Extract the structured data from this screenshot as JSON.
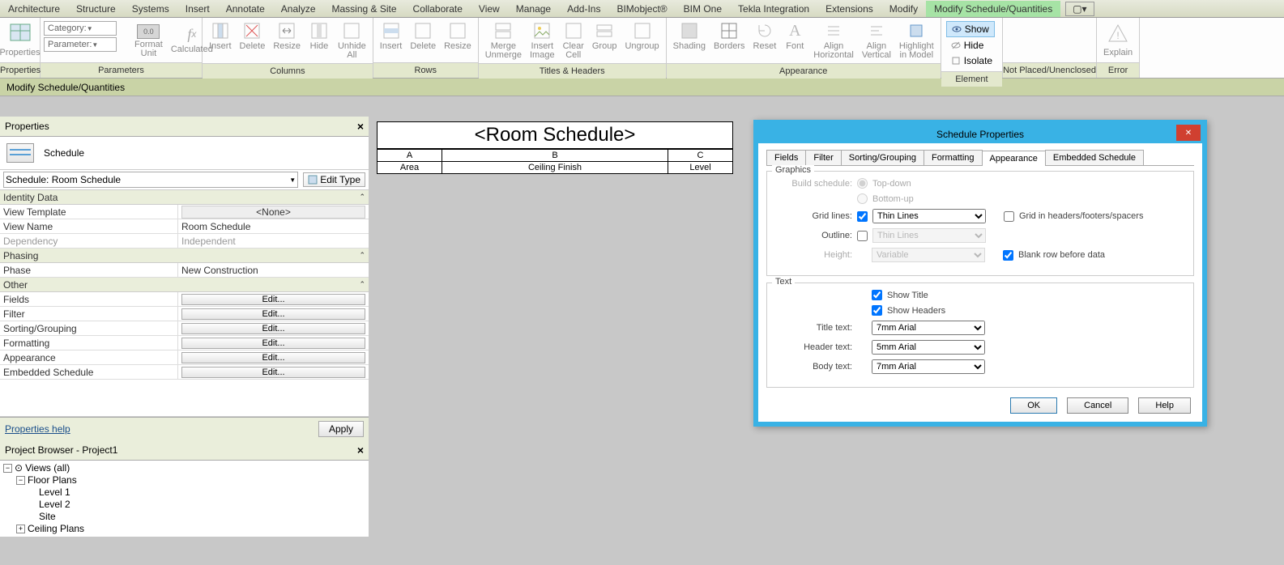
{
  "tabs": [
    "Architecture",
    "Structure",
    "Systems",
    "Insert",
    "Annotate",
    "Analyze",
    "Massing & Site",
    "Collaborate",
    "View",
    "Manage",
    "Add-Ins",
    "BIMobject®",
    "BIM One",
    "Tekla Integration",
    "Extensions",
    "Modify",
    "Modify Schedule/Quantities"
  ],
  "ribbon": {
    "properties": {
      "label": "Properties",
      "btn": "Properties",
      "category": "Category:",
      "parameter": "Parameter:",
      "format": "Format\nUnit",
      "calculated": "Calculated",
      "group": "Parameters"
    },
    "columns": {
      "insert": "Insert",
      "delete": "Delete",
      "resize": "Resize",
      "hide": "Hide",
      "unhide": "Unhide\nAll",
      "group": "Columns"
    },
    "rows": {
      "insert": "Insert",
      "delete": "Delete",
      "resize": "Resize",
      "group": "Rows"
    },
    "titles": {
      "merge": "Merge\nUnmerge",
      "image": "Insert\nImage",
      "clear": "Clear\nCell",
      "groupb": "Group",
      "ungroup": "Ungroup",
      "group": "Titles & Headers"
    },
    "appearance": {
      "shading": "Shading",
      "borders": "Borders",
      "reset": "Reset",
      "font": "Font",
      "alignh": "Align\nHorizontal",
      "alignv": "Align\nVertical",
      "highlight": "Highlight\nin Model",
      "group": "Appearance"
    },
    "element": {
      "show": "Show",
      "hide": "Hide",
      "isolate": "Isolate",
      "group": "Element"
    },
    "notplaced": {
      "explain": "Explain",
      "group": "Not Placed/Unenclosed",
      "error": "Error"
    }
  },
  "subtitle": "Modify Schedule/Quantities",
  "props": {
    "title": "Properties",
    "schedule": "Schedule",
    "typeRow": "Schedule: Room Schedule",
    "editType": "Edit Type",
    "identity": "Identity Data",
    "phasing": "Phasing",
    "other": "Other",
    "rows": {
      "vt": "View Template",
      "vtVal": "<None>",
      "vn": "View Name",
      "vnVal": "Room Schedule",
      "dep": "Dependency",
      "depVal": "Independent",
      "phase": "Phase",
      "phaseVal": "New Construction",
      "fields": "Fields",
      "filter": "Filter",
      "sorting": "Sorting/Grouping",
      "formatting": "Formatting",
      "appearance": "Appearance",
      "embedded": "Embedded Schedule",
      "edit": "Edit..."
    },
    "help": "Properties help",
    "apply": "Apply"
  },
  "browser": {
    "title": "Project Browser - Project1",
    "views": "Views (all)",
    "floor": "Floor Plans",
    "l1": "Level 1",
    "l2": "Level 2",
    "site": "Site",
    "ceiling": "Ceiling Plans"
  },
  "schedView": {
    "title": "<Room Schedule>",
    "cols": [
      "A",
      "B",
      "C"
    ],
    "headers": [
      "Area",
      "Ceiling Finish",
      "Level"
    ]
  },
  "dialog": {
    "title": "Schedule Properties",
    "tabs": [
      "Fields",
      "Filter",
      "Sorting/Grouping",
      "Formatting",
      "Appearance",
      "Embedded Schedule"
    ],
    "graphics": "Graphics",
    "text": "Text",
    "build": "Build schedule:",
    "topdown": "Top-down",
    "bottomup": "Bottom-up",
    "gridlines": "Grid lines:",
    "thin": "Thin Lines",
    "gridhf": "Grid in headers/footers/spacers",
    "outline": "Outline:",
    "height": "Height:",
    "variable": "Variable",
    "blank": "Blank row before data",
    "showtitle": "Show Title",
    "showheaders": "Show Headers",
    "titletext": "Title text:",
    "headertext": "Header text:",
    "bodytext": "Body text:",
    "arial7": "7mm Arial",
    "arial5": "5mm Arial",
    "ok": "OK",
    "cancel": "Cancel",
    "help": "Help"
  }
}
